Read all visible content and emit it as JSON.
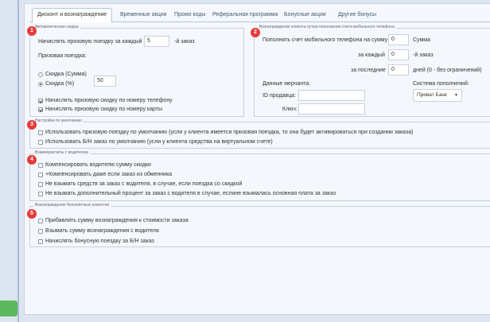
{
  "tabs": [
    {
      "label": "Дисконт и вознаграждение",
      "active": true
    },
    {
      "label": "Временные акции"
    },
    {
      "label": "Промо коды"
    },
    {
      "label": "Реферальная программа"
    },
    {
      "label": "Бонусные акции"
    },
    {
      "label": "Другие бонусы"
    }
  ],
  "badges": [
    "1",
    "2",
    "3",
    "4",
    "5"
  ],
  "badge_color": "#e53c3c",
  "section1": {
    "legend": "Автоматическая скидка",
    "accrue_prefix": "Начислять призовую поездку за каждый",
    "accrue_value": "5",
    "accrue_suffix": "-й заказ",
    "prize_label": "Призовая поездка:",
    "radio_sum": "Скидка (Сумма)",
    "radio_percent": "Скидка (%)",
    "percent_value": "50",
    "cb_phone": "Начислять призовую скидку по номеру телефону",
    "cb_card": "Начислять призовую скидку по номеру карты"
  },
  "section2": {
    "legend": "Вознаграждение клиента путем пополнения счета мобильного телефона",
    "topup_label": "Пополнять счет мобильного телефона на сумму",
    "topup_value": "0",
    "topup_suffix": "Сумма",
    "each_label": "за каждый",
    "each_value": "0",
    "each_suffix": "-й заказ",
    "last_label": "за последние",
    "last_value": "0",
    "last_suffix": "дней (0 - без ограничений)",
    "merchant_label": "Данные мерчанта:",
    "system_label": "Система пополнений:",
    "seller_id_label": "ID продавца:",
    "key_label": "Ключ:",
    "system_value": "Приват Банк"
  },
  "section3": {
    "legend": "Настройки по умолчанию",
    "cb1": "Использовать призовую поездку по умолчанию (усли у клиента имеется призовая поездка, то она будет активироваться при создании заказа)",
    "cb2": "Использовать Б/Н заказ по умолчанию (усли у клиента средства на виртуальном счете)"
  },
  "section4": {
    "legend": "Взаиморасчеты с водителем",
    "cb1": "Компенсировать водителю сумму скидки",
    "cb2": "+Компенсировать даже если заказ из обменника",
    "cb3": "Не взымать средств за заказ с водителя, в случае, если поездка со скидкой",
    "cb4": "Не взымать дополнительный процент за заказ с водителя в случае, еслине взымалась основная плата за заказ"
  },
  "section5": {
    "legend": "Вознаграждение безналичных клиентов",
    "cb1": "Прибавлять сумму вознаграждения к стоимости заказа",
    "cb2": "Взымать сумму вознаграждения с водителя",
    "cb3": "Начислять бонусную поездку за Б/Н заказ"
  }
}
